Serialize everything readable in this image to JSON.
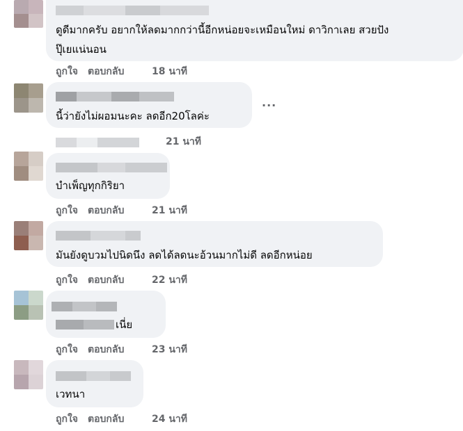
{
  "comments": [
    {
      "text_lines": [
        "ดูดีมากครับ อยากให้ลดมากกว่านี้อีกหน่อยจะเหมือนใหม่ ดาวิกาเลย สวยปัง",
        "ปุ๊เยแน่นอน"
      ],
      "like": "ถูกใจ",
      "reply": "ตอบกลับ",
      "time": "18 นาที"
    },
    {
      "text": "นี้ว่ายังไม่ผอมนะคะ ลดอีก20โลค่ะ",
      "time": "21 นาที"
    },
    {
      "text": "บำเพ็ญทุกกิริยา",
      "like": "ถูกใจ",
      "reply": "ตอบกลับ",
      "time": "21 นาที"
    },
    {
      "text": "มันยังดูบวมไปนิดนึง ลดได้ลดนะอ้วนมากไม่ดี ลดอีกหน่อย",
      "like": "ถูกใจ",
      "reply": "ตอบกลับ",
      "time": "22 นาที"
    },
    {
      "text": "เนี่ย",
      "like": "ถูกใจ",
      "reply": "ตอบกลับ",
      "time": "23 นาที"
    },
    {
      "text": "เวทนา",
      "like": "ถูกใจ",
      "reply": "ตอบกลับ",
      "time": "24 นาที"
    }
  ],
  "more_options": "···",
  "colors": {
    "bubble": "#f0f2f5",
    "meta_text": "#65676b",
    "text": "#050505"
  },
  "icons": [
    "more-options-icon"
  ]
}
